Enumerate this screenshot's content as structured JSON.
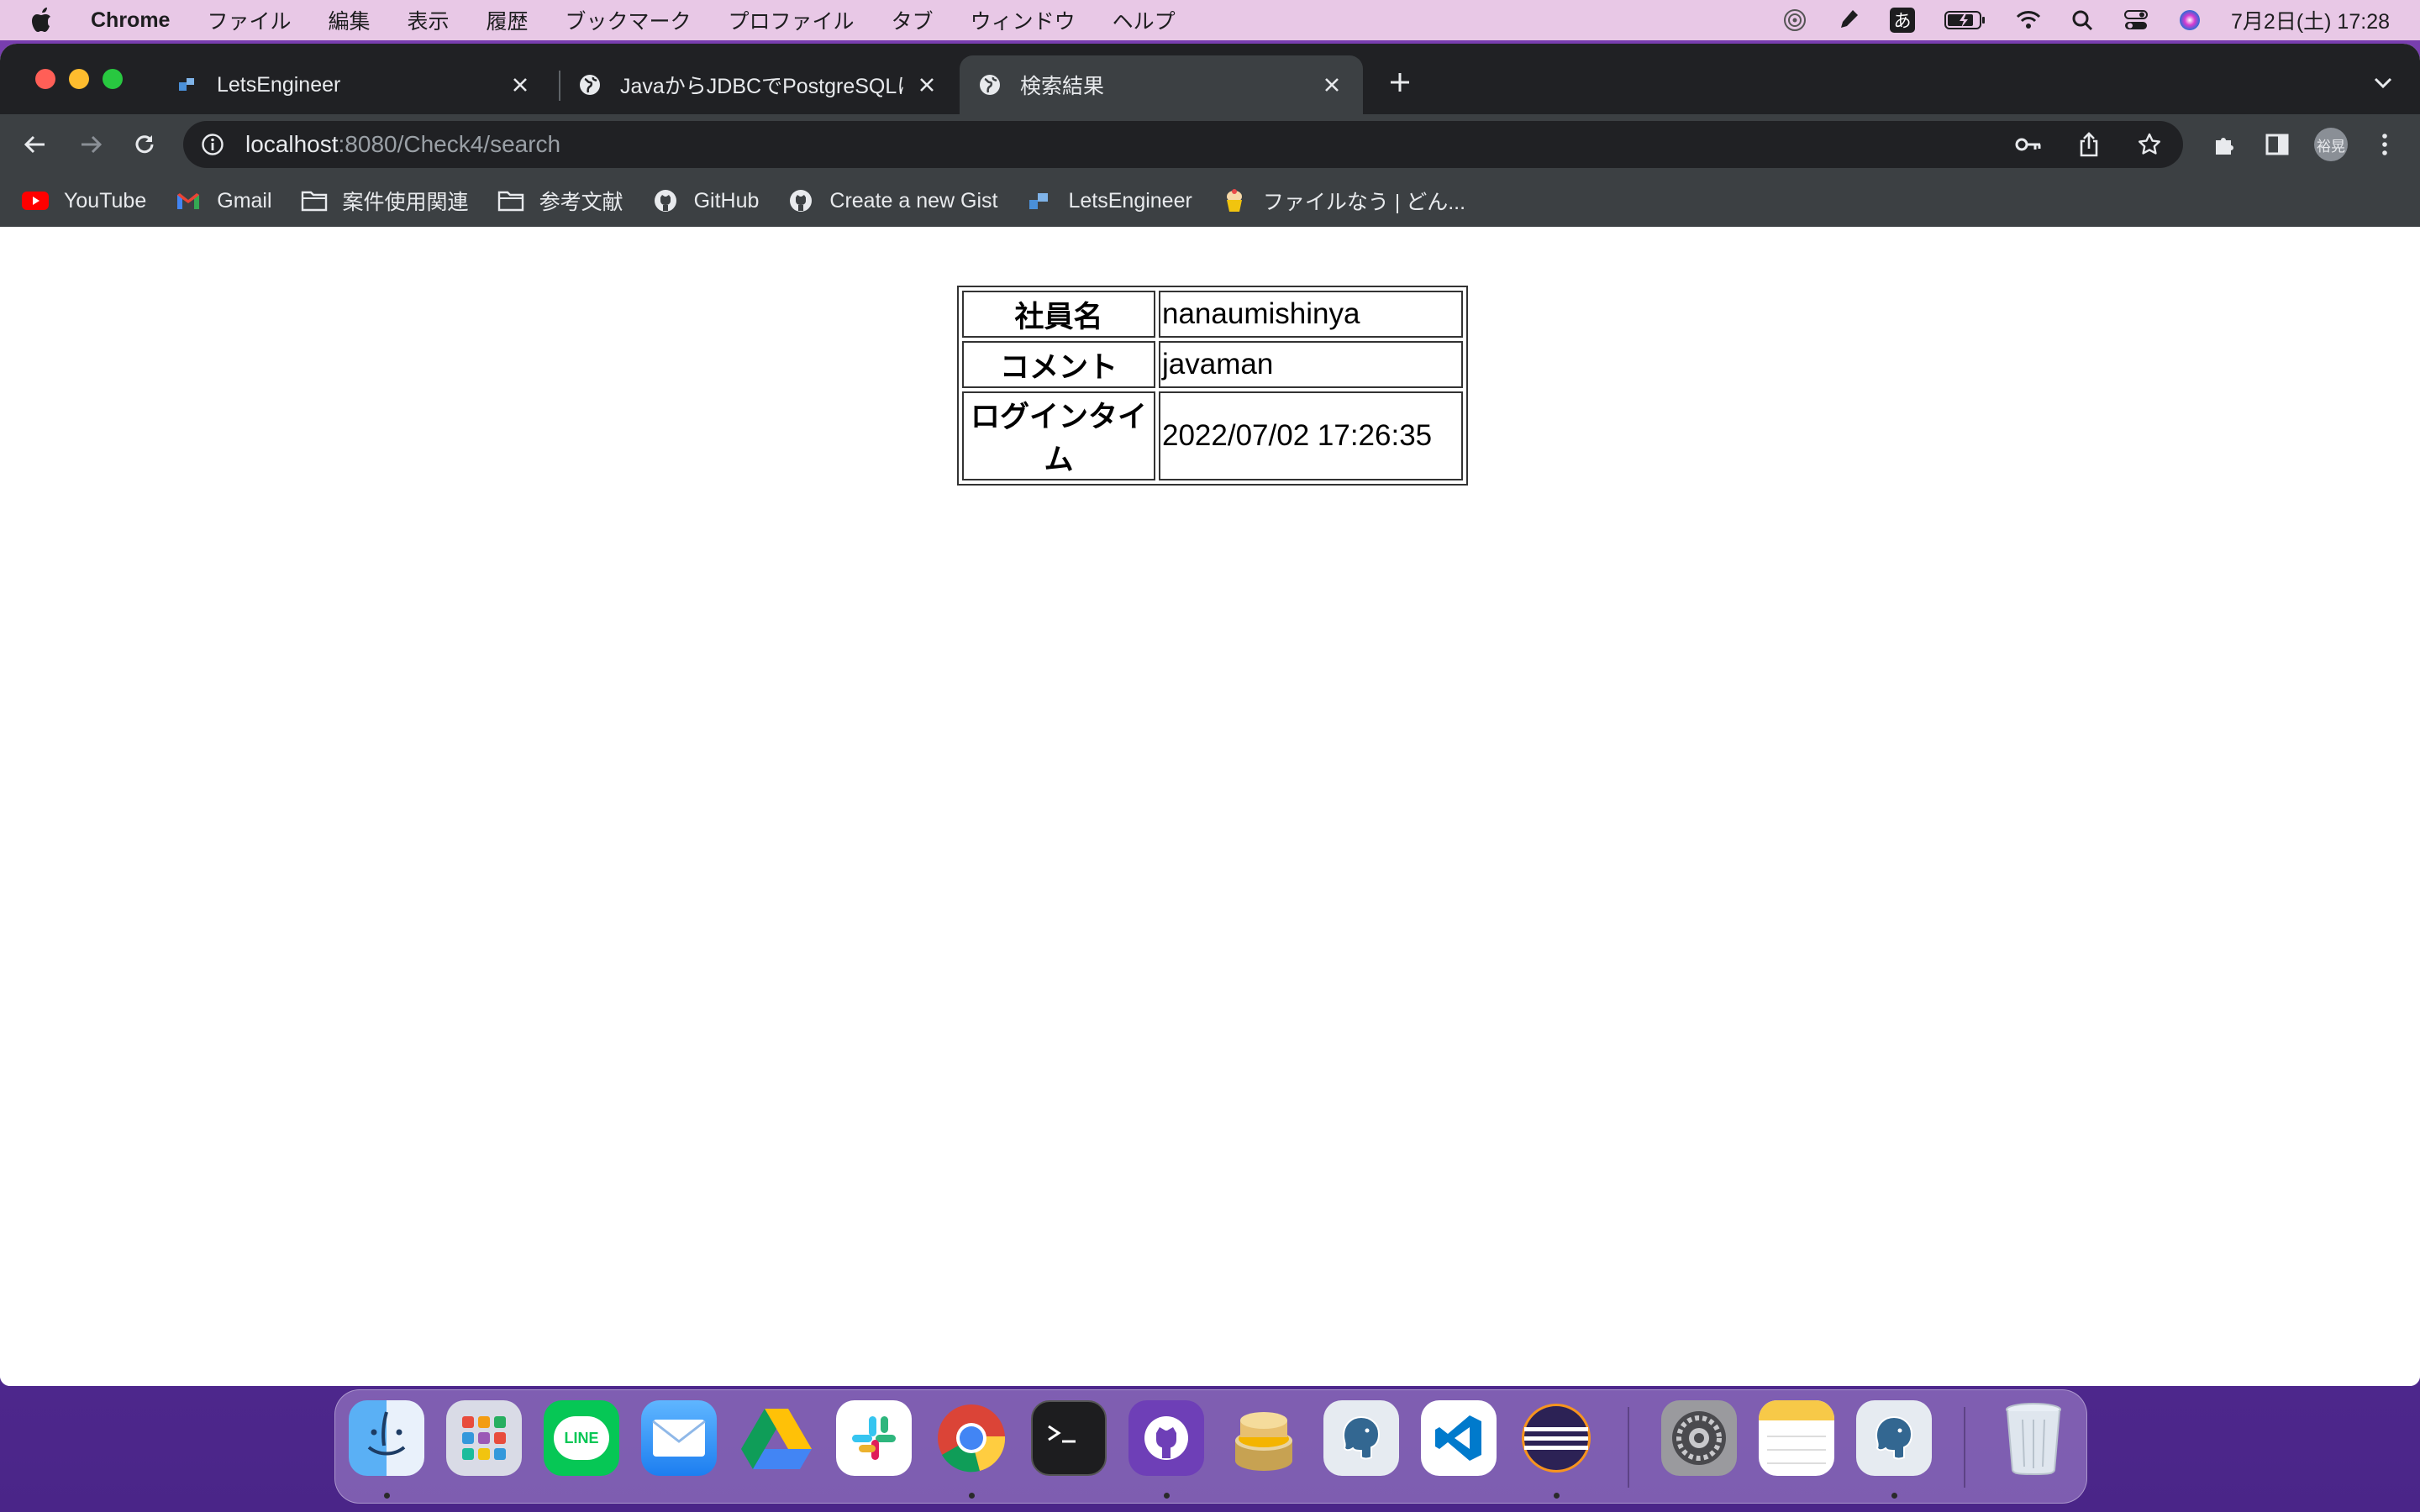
{
  "menubar": {
    "app_name": "Chrome",
    "items": [
      "ファイル",
      "編集",
      "表示",
      "履歴",
      "ブックマーク",
      "プロファイル",
      "タブ",
      "ウィンドウ",
      "ヘルプ"
    ],
    "ime_label": "あ",
    "clock": "7月2日(土)  17:28"
  },
  "tabs": [
    {
      "title": "LetsEngineer",
      "icon": "letsengineer-icon"
    },
    {
      "title": "JavaからJDBCでPostgreSQLに",
      "icon": "globe-icon"
    },
    {
      "title": "検索結果",
      "icon": "globe-icon",
      "active": true
    }
  ],
  "address": {
    "host": "localhost",
    "rest": ":8080/Check4/search"
  },
  "profile": {
    "initials": "裕晃"
  },
  "bookmarks": [
    {
      "label": "YouTube",
      "icon": "youtube-icon"
    },
    {
      "label": "Gmail",
      "icon": "gmail-icon"
    },
    {
      "label": "案件使用関連",
      "icon": "folder-icon"
    },
    {
      "label": "参考文献",
      "icon": "folder-icon"
    },
    {
      "label": "GitHub",
      "icon": "github-icon"
    },
    {
      "label": "Create a new Gist",
      "icon": "github-icon"
    },
    {
      "label": "LetsEngineer",
      "icon": "letsengineer-icon"
    },
    {
      "label": "ファイルなう | どん...",
      "icon": "cupcake-icon"
    }
  ],
  "result": {
    "rows": [
      {
        "header": "社員名",
        "value": "nanaumishinya"
      },
      {
        "header": "コメント",
        "value": "javaman"
      },
      {
        "header": "ログインタイム",
        "value": "2022/07/02 17:26:35"
      }
    ]
  },
  "dock": {
    "apps": [
      "Finder",
      "Launchpad",
      "LINE",
      "Mail",
      "Google Drive",
      "Slack",
      "Chrome",
      "Terminal",
      "GitHub Desktop",
      "Sequel Pro",
      "pgAdmin",
      "Visual Studio Code",
      "Eclipse",
      "System Preferences",
      "Notes",
      "pgAdmin",
      "Trash"
    ],
    "line_label": "LINE"
  },
  "colors": {
    "tab_bg": "#202124",
    "toolbar_bg": "#3c4043",
    "menubar_bg": "#e8c8e6"
  }
}
